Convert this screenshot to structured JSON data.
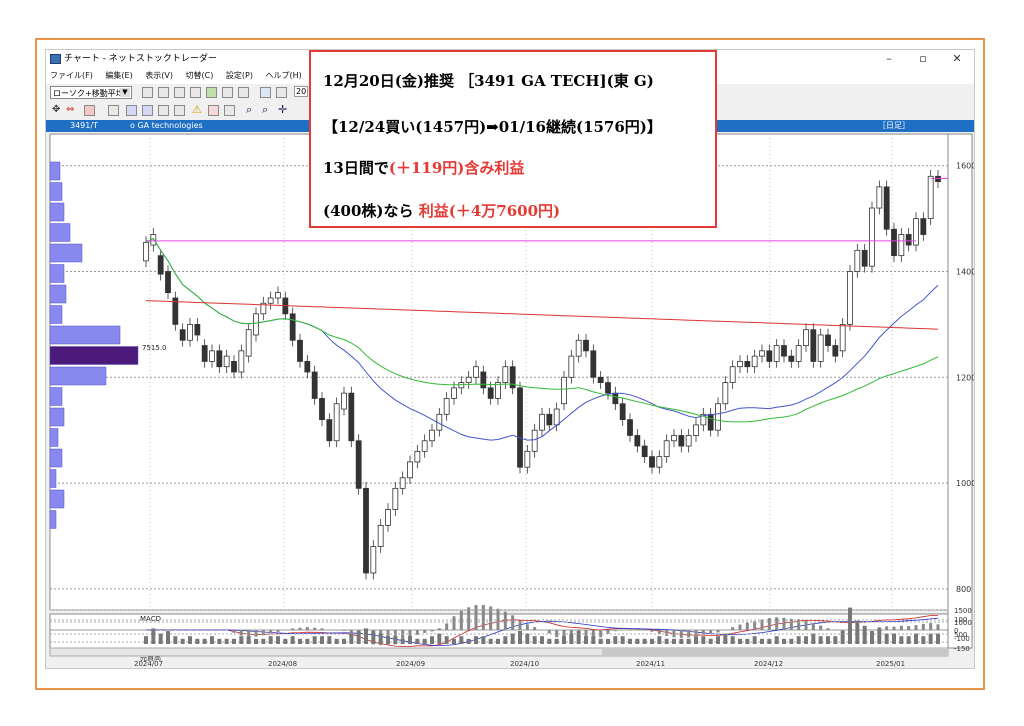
{
  "window": {
    "title": "チャート - ネットストックトレーダー",
    "minimize": "–",
    "maximize": "▫",
    "close": "✕"
  },
  "menu": [
    "ファイル(F)",
    "編集(E)",
    "表示(V)",
    "切替(C)",
    "設定(P)",
    "ヘルプ(H)"
  ],
  "toolbar": {
    "indicator_select": "ローソク+移動平均",
    "year_badge": "20"
  },
  "chart_header": {
    "code": "3491/T",
    "name": "o GA  technologies",
    "period": "［日足］"
  },
  "callout": {
    "line1": "12月20日(金)推奨 ［3491 GA TECH](東 G)",
    "line2": "【12/24買い(1457円)➡01/16継続(1576円)】",
    "line3_prefix": "13日間で",
    "line3_red": "(＋119円)含み利益",
    "line4_prefix": "(400株)なら ",
    "line4_red": "利益(＋4万7600円)"
  },
  "chart_data": {
    "type": "candlestick",
    "x_labels": [
      "2024/07",
      "2024/08",
      "2024/09",
      "2024/10",
      "2024/11",
      "2024/12",
      "2025/01"
    ],
    "y_ticks": [
      800,
      1000,
      1200,
      1400,
      1600
    ],
    "ylim": [
      760,
      1660
    ],
    "volume_profile_label": "7515.0",
    "macd": {
      "label": "MACD",
      "ticks": [
        "100",
        "0",
        "-100",
        "-150"
      ]
    },
    "volume": {
      "label": "売買高",
      "ticks": [
        "1500",
        "1000",
        "500"
      ]
    },
    "series_colors": {
      "ma_short": "#4455cc",
      "ma_mid": "#33bb33",
      "ma_long": "#dd3333",
      "resistance": "#dd44dd"
    },
    "candles": [
      [
        1420,
        1455
      ],
      [
        1450,
        1470
      ],
      [
        1430,
        1395
      ],
      [
        1400,
        1360
      ],
      [
        1350,
        1300
      ],
      [
        1290,
        1270
      ],
      [
        1270,
        1300
      ],
      [
        1300,
        1280
      ],
      [
        1260,
        1230
      ],
      [
        1230,
        1250
      ],
      [
        1250,
        1220
      ],
      [
        1220,
        1240
      ],
      [
        1230,
        1210
      ],
      [
        1210,
        1250
      ],
      [
        1240,
        1290
      ],
      [
        1280,
        1320
      ],
      [
        1320,
        1340
      ],
      [
        1340,
        1350
      ],
      [
        1350,
        1360
      ],
      [
        1350,
        1320
      ],
      [
        1320,
        1270
      ],
      [
        1270,
        1230
      ],
      [
        1230,
        1210
      ],
      [
        1210,
        1160
      ],
      [
        1160,
        1120
      ],
      [
        1120,
        1080
      ],
      [
        1080,
        1150
      ],
      [
        1140,
        1170
      ],
      [
        1170,
        1080
      ],
      [
        1080,
        990
      ],
      [
        990,
        830
      ],
      [
        830,
        880
      ],
      [
        880,
        920
      ],
      [
        920,
        950
      ],
      [
        950,
        990
      ],
      [
        990,
        1010
      ],
      [
        1010,
        1040
      ],
      [
        1040,
        1060
      ],
      [
        1060,
        1080
      ],
      [
        1080,
        1100
      ],
      [
        1100,
        1130
      ],
      [
        1130,
        1160
      ],
      [
        1160,
        1180
      ],
      [
        1180,
        1190
      ],
      [
        1190,
        1200
      ],
      [
        1200,
        1220
      ],
      [
        1210,
        1180
      ],
      [
        1180,
        1160
      ],
      [
        1160,
        1190
      ],
      [
        1190,
        1220
      ],
      [
        1220,
        1180
      ],
      [
        1180,
        1030
      ],
      [
        1030,
        1060
      ],
      [
        1060,
        1100
      ],
      [
        1100,
        1130
      ],
      [
        1130,
        1110
      ],
      [
        1110,
        1140
      ],
      [
        1150,
        1200
      ],
      [
        1200,
        1240
      ],
      [
        1240,
        1270
      ],
      [
        1270,
        1250
      ],
      [
        1250,
        1200
      ],
      [
        1200,
        1190
      ],
      [
        1190,
        1170
      ],
      [
        1170,
        1150
      ],
      [
        1150,
        1120
      ],
      [
        1120,
        1090
      ],
      [
        1090,
        1070
      ],
      [
        1070,
        1050
      ],
      [
        1050,
        1030
      ],
      [
        1030,
        1050
      ],
      [
        1050,
        1080
      ],
      [
        1080,
        1090
      ],
      [
        1090,
        1070
      ],
      [
        1070,
        1090
      ],
      [
        1090,
        1110
      ],
      [
        1110,
        1130
      ],
      [
        1130,
        1100
      ],
      [
        1100,
        1150
      ],
      [
        1150,
        1190
      ],
      [
        1190,
        1220
      ],
      [
        1220,
        1230
      ],
      [
        1230,
        1220
      ],
      [
        1220,
        1240
      ],
      [
        1240,
        1250
      ],
      [
        1250,
        1230
      ],
      [
        1230,
        1260
      ],
      [
        1260,
        1240
      ],
      [
        1240,
        1230
      ],
      [
        1230,
        1260
      ],
      [
        1260,
        1290
      ],
      [
        1290,
        1230
      ],
      [
        1230,
        1280
      ],
      [
        1280,
        1260
      ],
      [
        1260,
        1240
      ],
      [
        1250,
        1300
      ],
      [
        1300,
        1400
      ],
      [
        1400,
        1440
      ],
      [
        1440,
        1410
      ],
      [
        1410,
        1520
      ],
      [
        1520,
        1560
      ],
      [
        1560,
        1480
      ],
      [
        1480,
        1430
      ],
      [
        1430,
        1470
      ],
      [
        1470,
        1450
      ],
      [
        1450,
        1500
      ],
      [
        1500,
        1470
      ],
      [
        1500,
        1580
      ],
      [
        1580,
        1570
      ]
    ],
    "volumes": [
      3,
      6,
      4,
      5,
      3,
      2,
      3,
      2,
      2,
      3,
      2,
      2,
      2,
      3,
      3,
      2,
      2,
      3,
      3,
      2,
      3,
      2,
      2,
      3,
      3,
      3,
      2,
      2,
      4,
      5,
      6,
      5,
      4,
      3,
      3,
      2,
      3,
      2,
      2,
      3,
      4,
      3,
      2,
      3,
      2,
      3,
      3,
      2,
      2,
      3,
      4,
      5,
      4,
      3,
      3,
      2,
      2,
      3,
      4,
      5,
      3,
      3,
      2,
      2,
      3,
      3,
      2,
      2,
      2,
      2,
      3,
      2,
      2,
      2,
      2,
      3,
      3,
      2,
      3,
      4,
      3,
      2,
      2,
      3,
      2,
      2,
      3,
      2,
      2,
      3,
      3,
      4,
      3,
      3,
      3,
      5,
      14,
      9,
      7,
      5,
      6,
      4,
      4,
      3,
      3,
      4,
      3,
      4,
      4
    ]
  }
}
